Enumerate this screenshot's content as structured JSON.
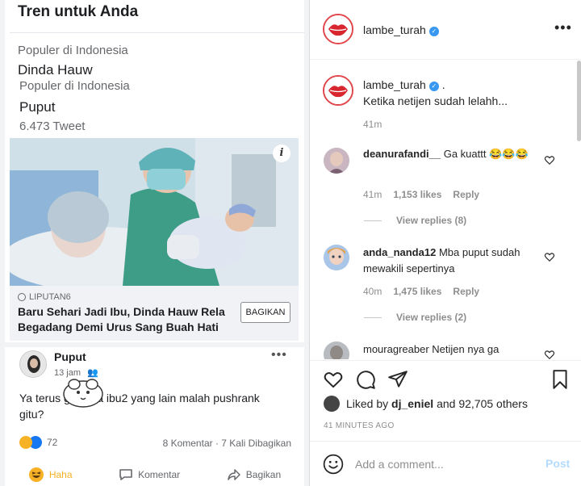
{
  "trends": {
    "title": "Tren untuk Anda",
    "items": [
      {
        "caption": "Populer di Indonesia",
        "name": "Dinda Hauw"
      },
      {
        "caption": "Populer di Indonesia",
        "name": "Puput",
        "count": "6.473 Tweet"
      }
    ]
  },
  "news": {
    "source": "LIPUTAN6",
    "headline": "Baru Sehari Jadi Ibu, Dinda Hauw Rela Begadang Demi Urus Sang Buah Hati",
    "share_label": "BAGIKAN",
    "info_icon": "info-icon"
  },
  "fb_post": {
    "author": "Puput",
    "time": "13 jam",
    "text": "Ya terus         g lo kira ibu2 yang lain malah pushrank gitu?",
    "reaction_count": "72",
    "counts": "8 Komentar · 7 Kali Dibagikan",
    "actions": {
      "haha": "Haha",
      "comment": "Komentar",
      "share": "Bagikan"
    }
  },
  "ig": {
    "header_user": "lambe_turah",
    "caption_user": "lambe_turah",
    "caption_text": ".",
    "caption_body": "Ketika netijen sudah lelahh...",
    "caption_time": "41m",
    "comments": [
      {
        "user": "deanurafandi__",
        "text": "Ga kuattt 😂😂😂",
        "time": "41m",
        "likes": "1,153 likes",
        "reply": "Reply",
        "view_replies": "View replies (8)"
      },
      {
        "user": "anda_nanda12",
        "text": "Mba puput sudah mewakili sepertinya",
        "time": "40m",
        "likes": "1,475 likes",
        "reply": "Reply",
        "view_replies": "View replies (2)"
      },
      {
        "user": "mouragreaber",
        "text": "Netijen nya ga"
      }
    ],
    "liked_by_prefix": "Liked by ",
    "liked_by_user": "dj_eniel",
    "liked_by_suffix": " and 92,705 others",
    "post_time": "41 MINUTES AGO",
    "comment_placeholder": "Add a comment...",
    "post_label": "Post"
  },
  "colors": {
    "ig_blue": "#3897f0",
    "post_disabled": "#b3dbff",
    "fb_blue": "#1877f2",
    "haha_yellow": "#f7b125"
  }
}
